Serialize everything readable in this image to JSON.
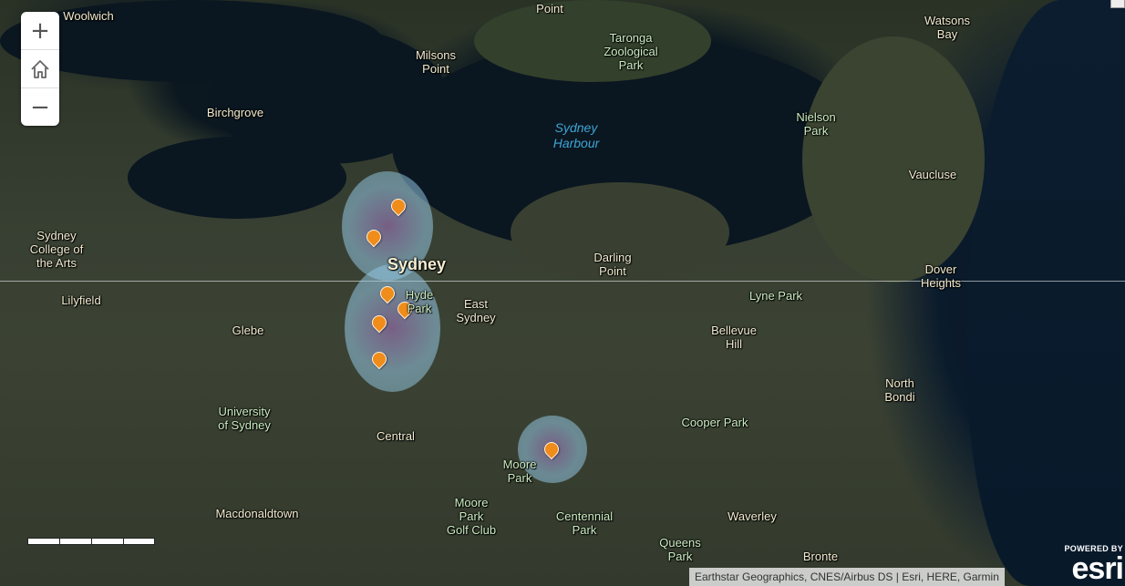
{
  "zoom_controls": {
    "zoom_in": "+",
    "home": "⌂",
    "zoom_out": "−"
  },
  "map": {
    "city_label": "Sydney",
    "water_label": "Sydney\nHarbour",
    "place_labels": [
      "Woolwich",
      "Point",
      "Milsons\nPoint",
      "Taronga\nZoological\nPark",
      "Watsons\nBay",
      "Birchgrove",
      "Nielson\nPark",
      "Vaucluse",
      "Sydney\nCollege of\nthe Arts",
      "Darling\nPoint",
      "Dover\nHeights",
      "Lilyfield",
      "Hyde\nPark",
      "East\nSydney",
      "Lyne Park",
      "Glebe",
      "Bellevue\nHill",
      "North\nBondi",
      "University\nof Sydney",
      "Central",
      "Cooper Park",
      "Moore\nPark",
      "Macdonaldtown",
      "Moore\nPark\nGolf Club",
      "Centennial\nPark",
      "Waverley",
      "Queens\nPark",
      "Bronte"
    ],
    "marker_count": 7,
    "colors": {
      "marker": "#f08c1a",
      "heat_outer": "#96d2eb",
      "heat_inner": "#aa78c8",
      "water_label": "#3fa6d6"
    }
  },
  "attribution": "Earthstar Geographics, CNES/Airbus DS | Esri, HERE, Garmin",
  "esri_logo": {
    "powered_by": "POWERED BY",
    "wordmark": "esri"
  }
}
